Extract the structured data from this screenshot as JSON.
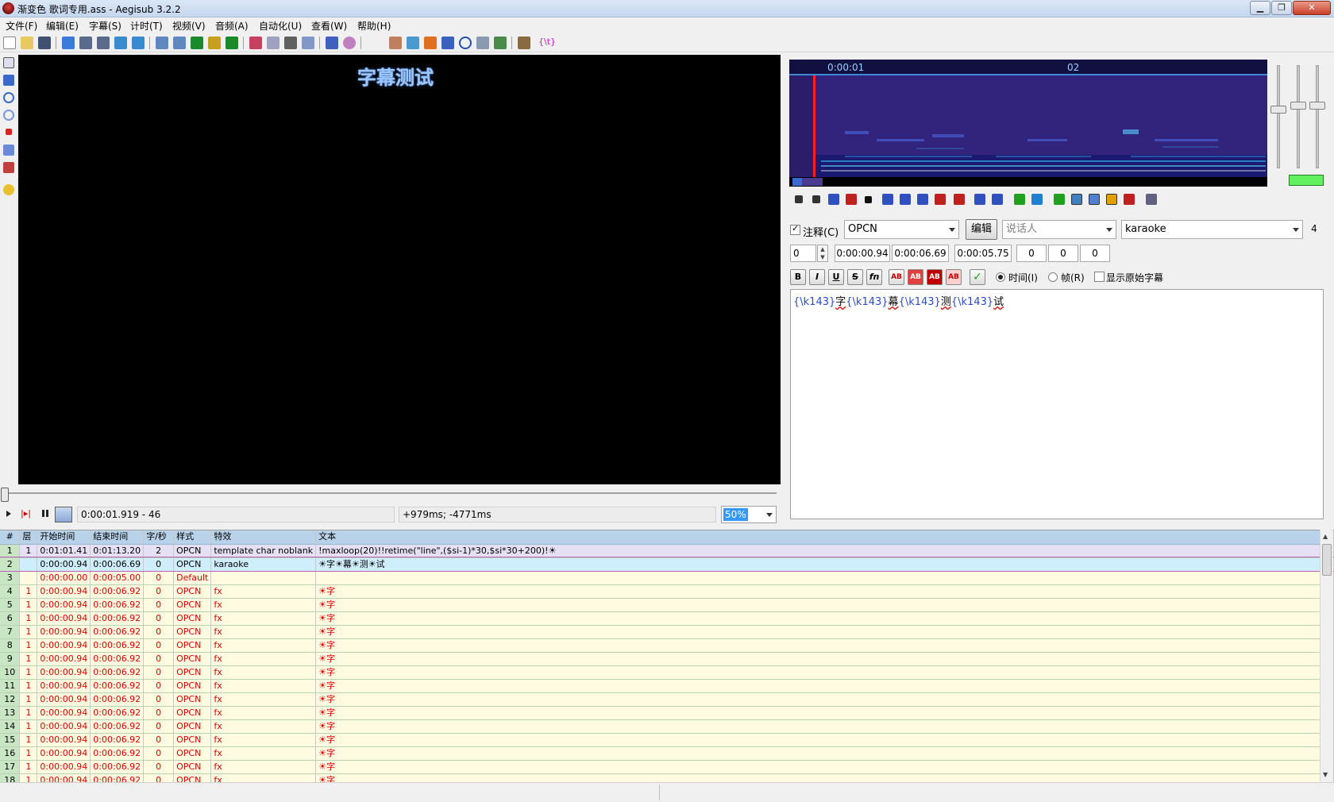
{
  "window": {
    "title": "渐变色 歌词专用.ass - Aegisub 3.2.2",
    "min": "▁",
    "restore": "❐",
    "close": "✕"
  },
  "menu": [
    "文件(F)",
    "编辑(E)",
    "字幕(S)",
    "计时(T)",
    "视频(V)",
    "音频(A)",
    "自动化(U)",
    "查看(W)",
    "帮助(H)"
  ],
  "toolbar": {
    "lua_label": "{\\t}"
  },
  "video": {
    "subtitle_text": "字幕测试",
    "time_readout": "0:00:01.919 - 46",
    "offset_readout": "+979ms; -4771ms",
    "zoom": "50%"
  },
  "audio": {
    "ruler_labels": [
      "0:00:01",
      "02"
    ],
    "colors": {
      "bg": "#2b1d6a",
      "marker": "#ff2020",
      "spectrum": "#35c8ff"
    }
  },
  "editor": {
    "comment_label": "注释(C)",
    "comment_checked": true,
    "style": "OPCN",
    "edit_button": "编辑",
    "actor_placeholder": "说话人",
    "effect": "karaoke",
    "layer_right": "4",
    "layer": "0",
    "start": "0:00:00.94",
    "end": "0:00:06.69",
    "duration": "0:00:05.75",
    "margin_l": "0",
    "margin_r": "0",
    "margin_v": "0",
    "fmt": [
      "B",
      "I",
      "U",
      "S",
      "fn"
    ],
    "color_btns": [
      "AB",
      "AB",
      "AB",
      "AB"
    ],
    "time_radio": "时间(I)",
    "frame_radio": "帧(R)",
    "show_original": "显示原始字幕",
    "text_tokens": [
      [
        "tag",
        "{\\k143}"
      ],
      [
        "txt",
        "字"
      ],
      [
        "tag",
        "{\\k143}"
      ],
      [
        "txt",
        "幕"
      ],
      [
        "tag",
        "{\\k143}"
      ],
      [
        "txt",
        "测"
      ],
      [
        "tag",
        "{\\k143}"
      ],
      [
        "txt",
        "试"
      ]
    ]
  },
  "grid": {
    "headers": [
      "#",
      "层",
      "开始时间",
      "结束时间",
      "字/秒",
      "样式",
      "特效",
      "文本"
    ],
    "rows": [
      [
        "1",
        "1",
        "0:01:01.41",
        "0:01:13.20",
        "2",
        "OPCN",
        "template char noblank",
        "!maxloop(20)!!retime(\"line\",($si-1)*30,$si*30+200)!☀"
      ],
      [
        "2",
        "",
        "0:00:00.94",
        "0:00:06.69",
        "0",
        "OPCN",
        "karaoke",
        "☀字☀幕☀测☀试"
      ],
      [
        "3",
        "",
        "0:00:00.00",
        "0:00:05.00",
        "0",
        "Default",
        "",
        ""
      ],
      [
        "4",
        "1",
        "0:00:00.94",
        "0:00:06.92",
        "0",
        "OPCN",
        "fx",
        "☀字"
      ],
      [
        "5",
        "1",
        "0:00:00.94",
        "0:00:06.92",
        "0",
        "OPCN",
        "fx",
        "☀字"
      ],
      [
        "6",
        "1",
        "0:00:00.94",
        "0:00:06.92",
        "0",
        "OPCN",
        "fx",
        "☀字"
      ],
      [
        "7",
        "1",
        "0:00:00.94",
        "0:00:06.92",
        "0",
        "OPCN",
        "fx",
        "☀字"
      ],
      [
        "8",
        "1",
        "0:00:00.94",
        "0:00:06.92",
        "0",
        "OPCN",
        "fx",
        "☀字"
      ],
      [
        "9",
        "1",
        "0:00:00.94",
        "0:00:06.92",
        "0",
        "OPCN",
        "fx",
        "☀字"
      ],
      [
        "10",
        "1",
        "0:00:00.94",
        "0:00:06.92",
        "0",
        "OPCN",
        "fx",
        "☀字"
      ],
      [
        "11",
        "1",
        "0:00:00.94",
        "0:00:06.92",
        "0",
        "OPCN",
        "fx",
        "☀字"
      ],
      [
        "12",
        "1",
        "0:00:00.94",
        "0:00:06.92",
        "0",
        "OPCN",
        "fx",
        "☀字"
      ],
      [
        "13",
        "1",
        "0:00:00.94",
        "0:00:06.92",
        "0",
        "OPCN",
        "fx",
        "☀字"
      ],
      [
        "14",
        "1",
        "0:00:00.94",
        "0:00:06.92",
        "0",
        "OPCN",
        "fx",
        "☀字"
      ],
      [
        "15",
        "1",
        "0:00:00.94",
        "0:00:06.92",
        "0",
        "OPCN",
        "fx",
        "☀字"
      ],
      [
        "16",
        "1",
        "0:00:00.94",
        "0:00:06.92",
        "0",
        "OPCN",
        "fx",
        "☀字"
      ],
      [
        "17",
        "1",
        "0:00:00.94",
        "0:00:06.92",
        "0",
        "OPCN",
        "fx",
        "☀字"
      ],
      [
        "18",
        "1",
        "0:00:00.94",
        "0:00:06.92",
        "0",
        "OPCN",
        "fx",
        "☀字"
      ]
    ],
    "row_kinds": [
      "comment",
      "selected",
      "red",
      "red",
      "red",
      "red",
      "red",
      "red",
      "red",
      "red",
      "red",
      "red",
      "red",
      "red",
      "red",
      "red",
      "red",
      "red"
    ],
    "colors": {
      "comment": "#e6e0f4",
      "selected": "#cfeefc",
      "red_bg": "#fffbe0",
      "red_text": "#e00000",
      "number_col": "#c8e6c4"
    }
  }
}
